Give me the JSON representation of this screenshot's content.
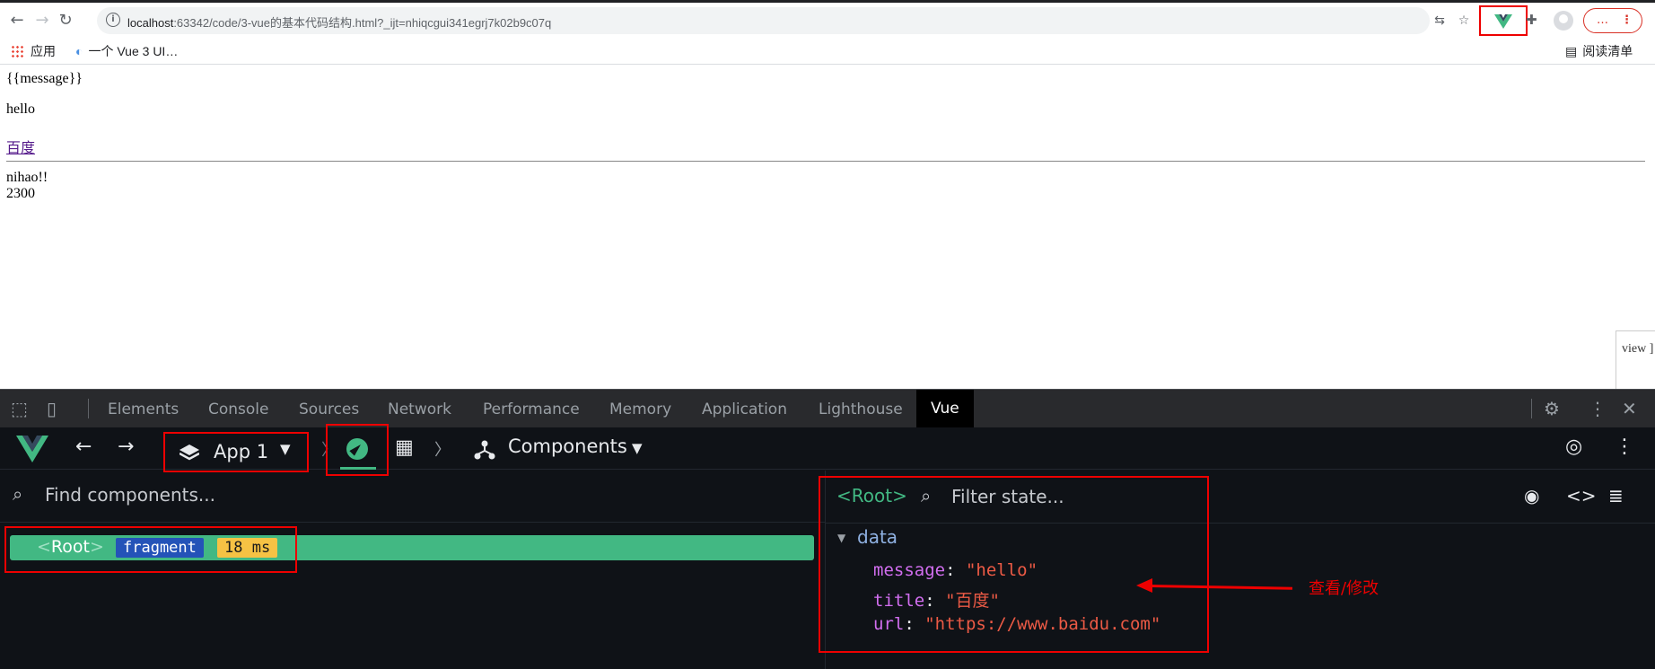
{
  "browser": {
    "url_host": "localhost",
    "url_path": ":63342/code/3-vue的基本代码结构.html?_ijt=nhiqcgui341egrj7k02b9c07q",
    "menu_label": "…",
    "icons": [
      "back-arrow-icon",
      "forward-arrow-icon",
      "reload-icon",
      "info-icon",
      "translate-icon",
      "star-icon",
      "vue-extension-icon",
      "puzzle-icon",
      "profile-icon",
      "kebab-menu-icon"
    ]
  },
  "bookmarks": {
    "apps": "应用",
    "item1": "一个 Vue 3 UI…",
    "reading_list": "阅读清单"
  },
  "page": {
    "raw": "{{message}}",
    "hello": "hello",
    "link": "百度",
    "line1": "nihao!!",
    "line2": "2300",
    "side": "view ]"
  },
  "devtools": {
    "tabs": [
      "Elements",
      "Console",
      "Sources",
      "Network",
      "Performance",
      "Memory",
      "Application",
      "Lighthouse",
      "Vue"
    ]
  },
  "vue": {
    "app_label": "App 1",
    "components_label": "Components",
    "find_placeholder": "Find components...",
    "root_tag": "Root",
    "badge_fragment": "fragment",
    "badge_ms": "18 ms",
    "state_root": "<Root>",
    "filter_placeholder": "Filter state...",
    "data_heading": "data",
    "state": [
      {
        "key": "message",
        "value": "\"hello\""
      },
      {
        "key": "title",
        "value": "\"百度\""
      },
      {
        "key": "url",
        "value": "\"https://www.baidu.com\""
      }
    ],
    "annotation": "查看/修改"
  },
  "colors": {
    "accent": "#42b883",
    "highlight": "#e00000"
  }
}
